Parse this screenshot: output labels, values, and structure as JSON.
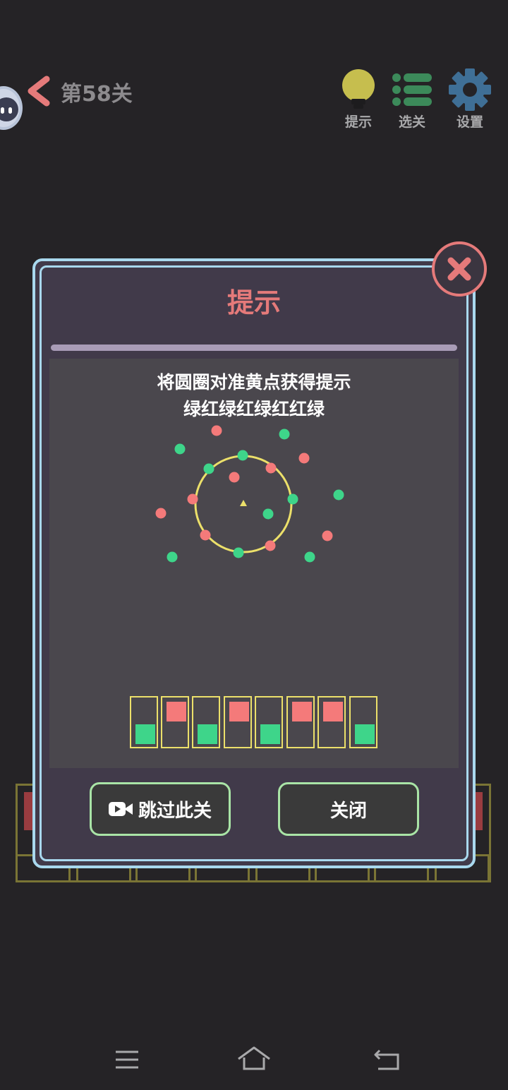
{
  "header": {
    "level_title": "第58关",
    "toolbar": [
      {
        "label": "提示",
        "icon": "lightbulb-icon"
      },
      {
        "label": "选关",
        "icon": "list-icon"
      },
      {
        "label": "设置",
        "icon": "gear-icon"
      }
    ]
  },
  "modal": {
    "title": "提示",
    "hint_line1": "将圆圈对准黄点获得提示",
    "hint_line2": "绿红绿红绿红红绿",
    "sequence": [
      "green",
      "red",
      "green",
      "red",
      "green",
      "red",
      "red",
      "green"
    ],
    "skip_label": "跳过此关",
    "close_label": "关闭"
  },
  "colors": {
    "red": "#f47a7a",
    "green": "#3ed58a",
    "yellow": "#ece06a",
    "accent_border": "#a9d8ee",
    "button_border": "#a9e4a6"
  }
}
